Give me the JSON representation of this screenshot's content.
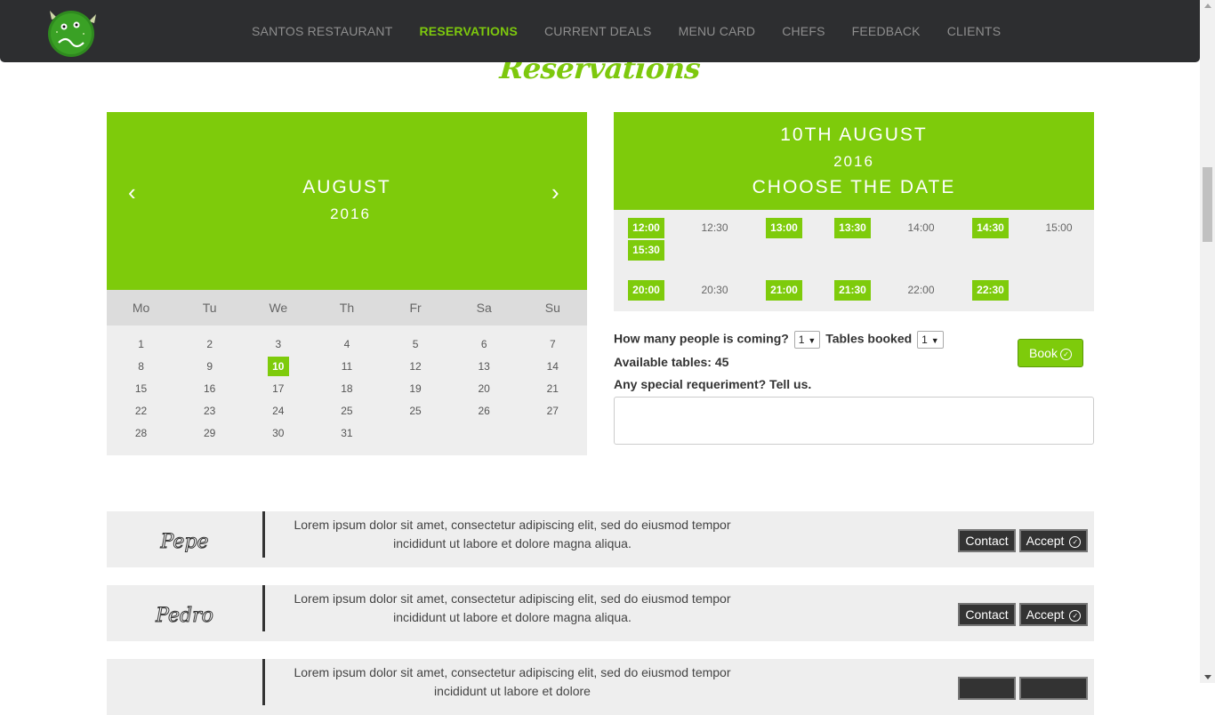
{
  "nav": {
    "items": [
      {
        "label": "SANTOS RESTAURANT",
        "active": false
      },
      {
        "label": "RESERVATIONS",
        "active": true
      },
      {
        "label": "CURRENT DEALS",
        "active": false
      },
      {
        "label": "MENU CARD",
        "active": false
      },
      {
        "label": "CHEFS",
        "active": false
      },
      {
        "label": "FEEDBACK",
        "active": false
      },
      {
        "label": "CLIENTS",
        "active": false
      }
    ]
  },
  "page_title": "Reservations",
  "calendar": {
    "month": "AUGUST",
    "year": "2016",
    "prev_icon": "‹",
    "next_icon": "›",
    "weekdays": [
      "Mo",
      "Tu",
      "We",
      "Th",
      "Fr",
      "Sa",
      "Su"
    ],
    "selected_day": "10",
    "weeks": [
      [
        "1",
        "2",
        "3",
        "4",
        "5",
        "6",
        "7"
      ],
      [
        "8",
        "9",
        "10",
        "11",
        "12",
        "13",
        "14"
      ],
      [
        "15",
        "16",
        "17",
        "18",
        "19",
        "20",
        "21"
      ],
      [
        "22",
        "23",
        "24",
        "25",
        "25",
        "26",
        "27"
      ],
      [
        "28",
        "29",
        "30",
        "31",
        "",
        "",
        ""
      ]
    ]
  },
  "reservation": {
    "date_label": "10TH AUGUST",
    "year": "2016",
    "choose_label": "CHOOSE THE DATE",
    "slots": [
      {
        "time": "12:00",
        "available": true
      },
      {
        "time": "12:30",
        "available": false
      },
      {
        "time": "13:00",
        "available": true
      },
      {
        "time": "13:30",
        "available": true
      },
      {
        "time": "14:00",
        "available": false
      },
      {
        "time": "14:30",
        "available": true
      },
      {
        "time": "15:00",
        "available": false
      },
      {
        "time": "15:30",
        "available": true
      },
      {
        "time": "20:00",
        "available": true
      },
      {
        "time": "20:30",
        "available": false
      },
      {
        "time": "21:00",
        "available": true
      },
      {
        "time": "21:30",
        "available": true
      },
      {
        "time": "22:00",
        "available": false
      },
      {
        "time": "22:30",
        "available": true
      }
    ],
    "people_label": "How many people is coming?",
    "people_value": "1",
    "tables_label": "Tables booked",
    "tables_value": "1",
    "available_label": "Available tables: 45",
    "special_label": "Any special requeriment? Tell us.",
    "textarea_value": "",
    "book_label": "Book"
  },
  "requests": [
    {
      "name": "Pepe",
      "text": "Lorem ipsum dolor sit amet, consectetur adipiscing elit, sed do eiusmod tempor incididunt ut labore et dolore magna aliqua.",
      "contact_label": "Contact",
      "accept_label": "Accept"
    },
    {
      "name": "Pedro",
      "text": "Lorem ipsum dolor sit amet, consectetur adipiscing elit, sed do eiusmod tempor incididunt ut labore et dolore magna aliqua.",
      "contact_label": "Contact",
      "accept_label": "Accept"
    },
    {
      "name": "",
      "text": "Lorem ipsum dolor sit amet, consectetur adipiscing elit, sed do eiusmod tempor incididunt ut labore et dolore",
      "contact_label": "",
      "accept_label": ""
    }
  ],
  "colors": {
    "accent": "#7ecb0b",
    "navbar": "#2d2e30",
    "panel": "#eeeeee"
  },
  "icons": {
    "logo": "monster-logo-icon",
    "check": "check-circle-icon"
  }
}
